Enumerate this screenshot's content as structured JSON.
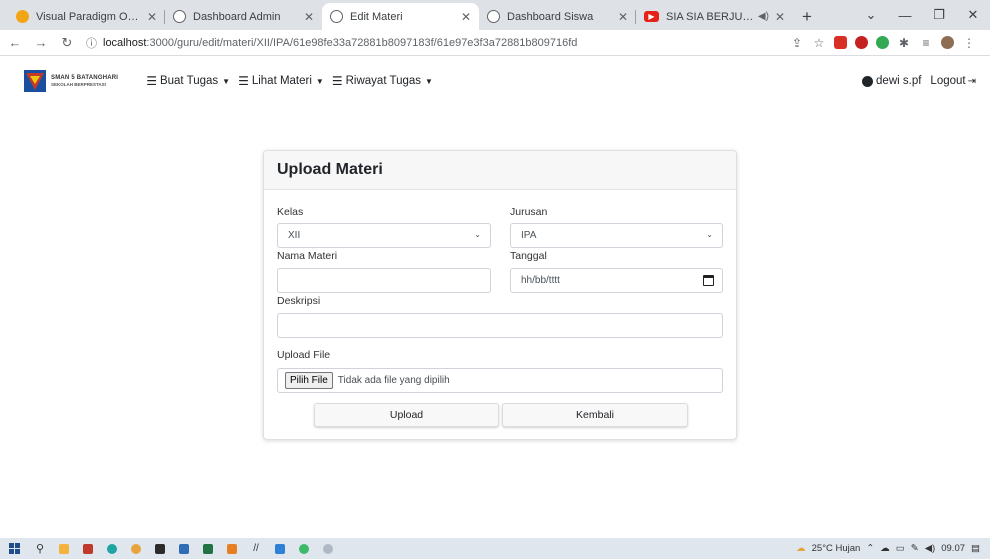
{
  "browser": {
    "tabs": [
      {
        "title": "Visual Paradigm Online",
        "icon": "visual-paradigm-icon",
        "active": false
      },
      {
        "title": "Dashboard Admin",
        "icon": "globe-icon",
        "active": false
      },
      {
        "title": "Edit Materi",
        "icon": "globe-icon",
        "active": true
      },
      {
        "title": "Dashboard Siswa",
        "icon": "globe-icon",
        "active": false
      },
      {
        "title": "SIA SIA BERJUANG, AKU BUI",
        "icon": "youtube-icon",
        "active": false
      }
    ],
    "url_host": "localhost",
    "url_path": ":3000/guru/edit/materi/XII/IPA/61e98fe33a72881b8097183f/61e97e3f3a72881b809716fd"
  },
  "navbar": {
    "brand_name": "SMAN 5 BATANGHARI",
    "brand_sub": "SEKOLAH BERPRESTASI",
    "menu": [
      {
        "label": "Buat Tugas"
      },
      {
        "label": "Lihat Materi"
      },
      {
        "label": "Riwayat Tugas"
      }
    ],
    "user": "dewi s.pf",
    "logout": "Logout"
  },
  "form": {
    "title": "Upload Materi",
    "kelas_label": "Kelas",
    "kelas_value": "XII",
    "jurusan_label": "Jurusan",
    "jurusan_value": "IPA",
    "nama_label": "Nama Materi",
    "nama_value": "",
    "tanggal_label": "Tanggal",
    "tanggal_placeholder": "hh/bb/tttt",
    "deskripsi_label": "Deskripsi",
    "deskripsi_value": "",
    "file_label": "Upload File",
    "file_button": "Pilih File",
    "file_status": "Tidak ada file yang dipilih",
    "upload_button": "Upload",
    "back_button": "Kembali"
  },
  "taskbar": {
    "weather": "25°C  Hujan",
    "time": "09.07"
  },
  "colors": {
    "accent_red": "#c0392b",
    "accent_blue": "#1a4fa0",
    "youtube_red": "#e62117"
  }
}
